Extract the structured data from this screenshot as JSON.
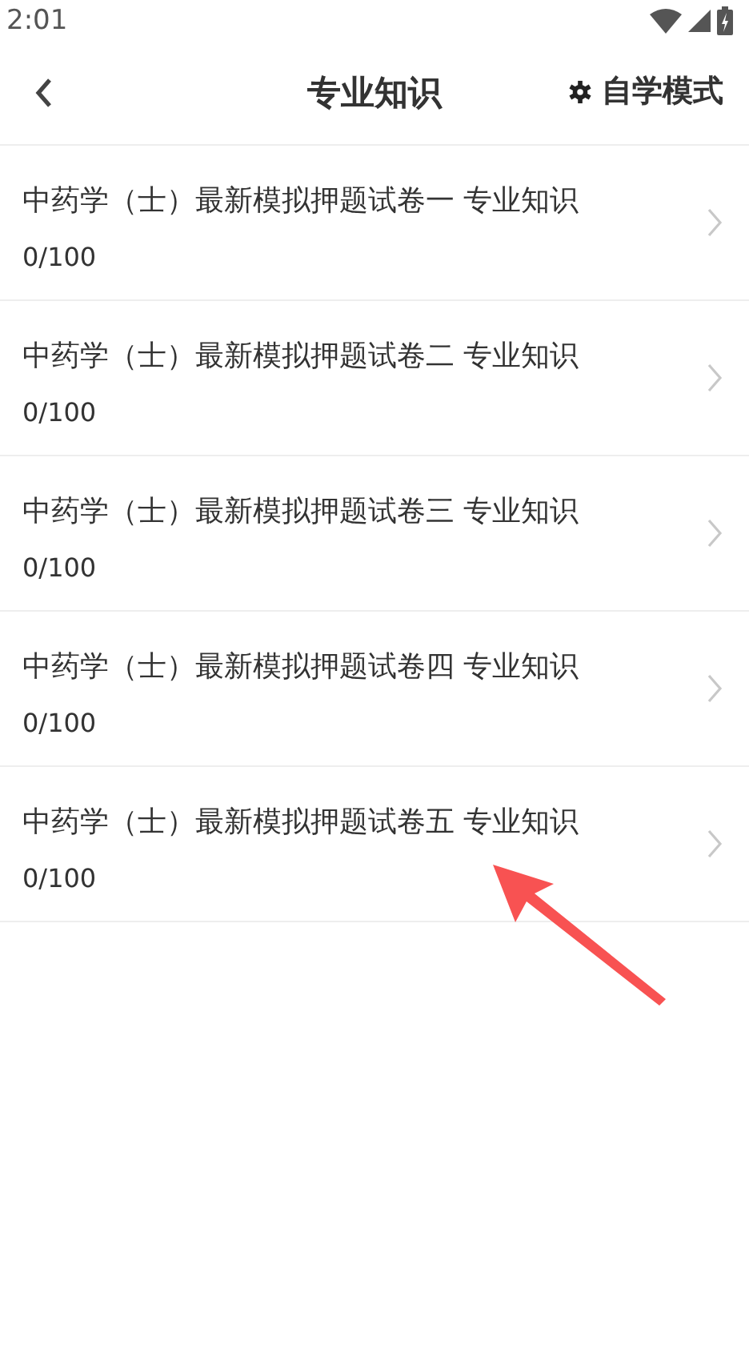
{
  "status_bar": {
    "time": "2:01"
  },
  "header": {
    "title": "专业知识",
    "mode_label": "自学模式"
  },
  "papers": [
    {
      "title": "中药学（士）最新模拟押题试卷一 专业知识",
      "score": "0/100"
    },
    {
      "title": "中药学（士）最新模拟押题试卷二 专业知识",
      "score": "0/100"
    },
    {
      "title": "中药学（士）最新模拟押题试卷三 专业知识",
      "score": "0/100"
    },
    {
      "title": "中药学（士）最新模拟押题试卷四 专业知识",
      "score": "0/100"
    },
    {
      "title": "中药学（士）最新模拟押题试卷五 专业知识",
      "score": "0/100"
    }
  ]
}
